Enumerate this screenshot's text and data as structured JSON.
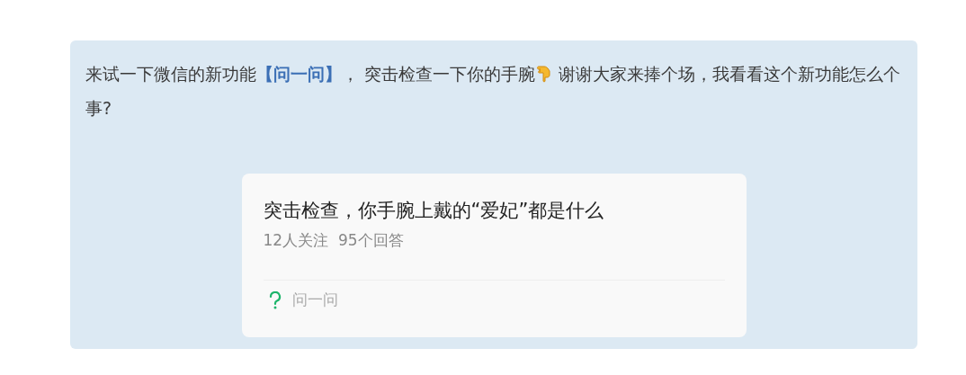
{
  "post": {
    "text_before": "来试一下微信的新功能**【问一问】**， 突击检查一下你的手腕",
    "text_after": " 谢谢大家来捧个场，我看看这个新功能怎么个事?"
  },
  "question_card": {
    "title": "突击检查，你手腕上戴的“爱妃”都是什么",
    "meta": "12人关注  95个回答",
    "footer_label": "问一问"
  }
}
